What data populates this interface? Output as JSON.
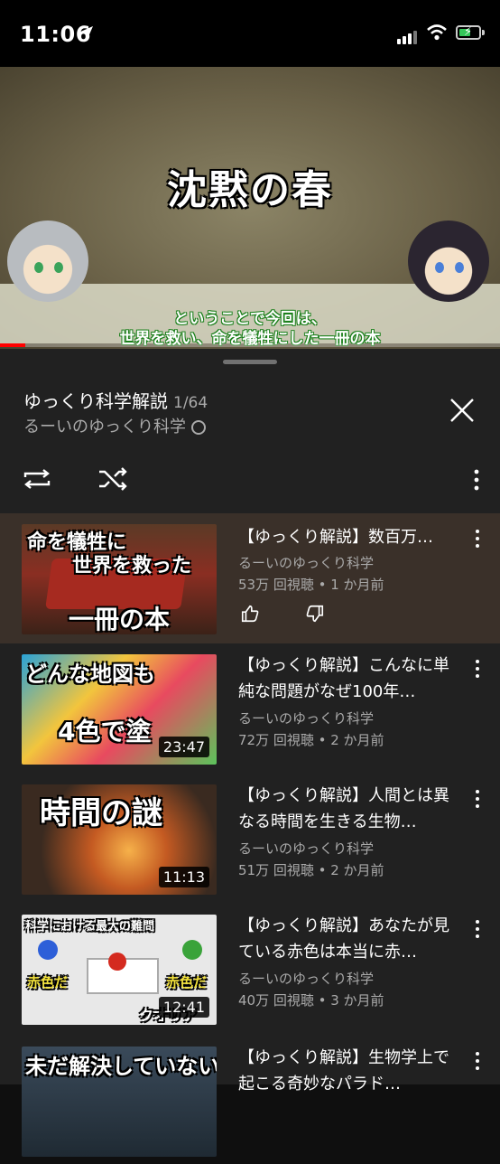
{
  "status_bar": {
    "time": "11:06"
  },
  "player": {
    "headline": "沈黙の春",
    "subtitle_line1": "ということで今回は、",
    "subtitle_line2": "世界を救い、命を犠牲にした一冊の本",
    "progress": 0.05,
    "colors": {
      "progress": "#ff0000"
    }
  },
  "playlist": {
    "title": "ゆっくり科学解説",
    "count": "1/64",
    "channel": "るーいのゆっくり科学",
    "icons": [
      "globe-icon",
      "close-icon",
      "loop-icon",
      "shuffle-icon",
      "more-vert-icon"
    ]
  },
  "videos": [
    {
      "title": "【ゆっくり解説】数百万…",
      "channel": "るーいのゆっくり科学",
      "meta": "53万 回視聴 • 1 か月前",
      "thumb_text1": "命を犠牲に",
      "thumb_text2": "世界を救った",
      "thumb_text3": "一冊の本",
      "duration": ""
    },
    {
      "title": "【ゆっくり解説】こんなに単純な問題がなぜ100年…",
      "channel": "るーいのゆっくり科学",
      "meta": "72万 回視聴 • 2 か月前",
      "thumb_text1": "どんな地図も",
      "thumb_text2": "4色で塗",
      "duration": "23:47"
    },
    {
      "title": "【ゆっくり解説】人間とは異なる時間を生きる生物…",
      "channel": "るーいのゆっくり科学",
      "meta": "51万 回視聴 • 2 か月前",
      "thumb_text1": "時間の謎",
      "duration": "11:13"
    },
    {
      "title": "【ゆっくり解説】あなたが見ている赤色は本当に赤…",
      "channel": "るーいのゆっくり科学",
      "meta": "40万 回視聴 • 3 か月前",
      "thumb_text1": "科学における最大の難問",
      "thumb_text2": "赤色だ",
      "thumb_text3": "赤色だ",
      "thumb_text4": "クオリア",
      "duration": "12:41"
    },
    {
      "title": "【ゆっくり解説】生物学上で起こる奇妙なパラド…",
      "thumb_text1": "未だ解決していない"
    }
  ]
}
